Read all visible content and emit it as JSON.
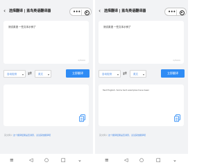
{
  "screens": [
    {
      "nav": {
        "back_icon": "chevron-left-icon",
        "title": "选择翻译 | 蓝鸟英语翻译器"
      },
      "input": {
        "text": "测试英语  一些文本示例了",
        "counter": "0/5000"
      },
      "controls": {
        "source_lang": "自动检测",
        "target_lang": "英文",
        "translate_label": "立即翻译"
      },
      "output": {
        "text": ""
      },
      "footer": {
        "prefix": "英文释义",
        "link": "这个翻译结果是否满意，试试其他翻译吧"
      }
    },
    {
      "nav": {
        "back_icon": "chevron-left-icon",
        "title": "选择翻译 | 蓝鸟英语翻译器"
      },
      "input": {
        "text": "测试英语  一些文本示例了",
        "counter": "0/5000"
      },
      "controls": {
        "source_lang": "自动检测",
        "target_lang": "英文",
        "translate_label": "立即翻译"
      },
      "output": {
        "text": "Test English. Some text examples have been"
      },
      "footer": {
        "prefix": "英文释义",
        "link": "这个翻译结果是否满意，试试其他翻译吧"
      }
    }
  ],
  "colors": {
    "accent": "#2f8cf5",
    "link": "#4a8be6",
    "background": "#f2f3f5"
  },
  "system_nav": [
    "menu-icon",
    "home-icon",
    "back-triangle-icon"
  ]
}
